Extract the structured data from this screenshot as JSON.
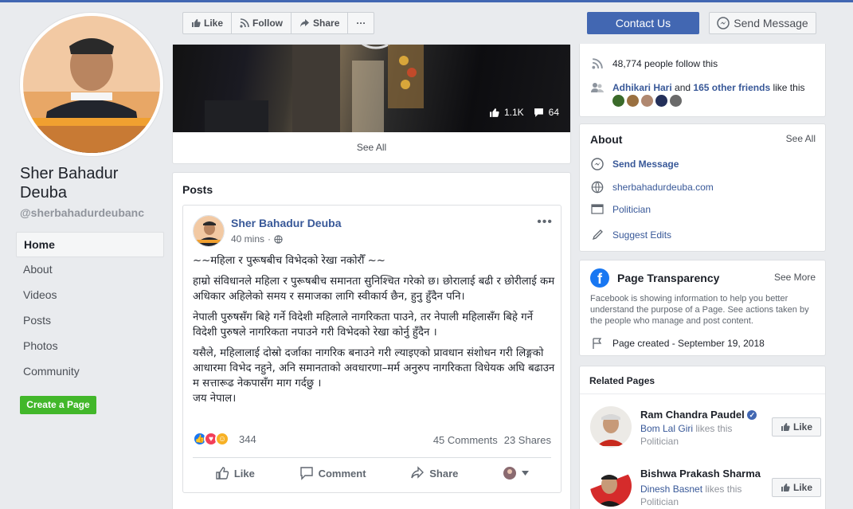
{
  "page": {
    "name": "Sher Bahadur Deuba",
    "username": "@sherbahadurdeubanc"
  },
  "nav": [
    "Home",
    "About",
    "Videos",
    "Posts",
    "Photos",
    "Community"
  ],
  "create_page_label": "Create a Page",
  "actions": {
    "like": "Like",
    "follow": "Follow",
    "share": "Share",
    "more": "···",
    "contact": "Contact Us",
    "send_message": "Send Message"
  },
  "video": {
    "likes": "1.1K",
    "comments": "64",
    "see_all": "See All"
  },
  "community": {
    "follow_count": "48,774 people follow this",
    "friend_name": "Adhikari Hari",
    "friend_connector": "and",
    "friend_others": "165 other friends",
    "friend_suffix": "like this"
  },
  "about": {
    "title": "About",
    "see_all": "See All",
    "send_message": "Send Message",
    "website": "sherbahadurdeuba.com",
    "category": "Politician",
    "suggest_edits": "Suggest Edits"
  },
  "transparency": {
    "title": "Page Transparency",
    "see_more": "See More",
    "description": "Facebook is showing information to help you better understand the purpose of a Page. See actions taken by the people who manage and post content.",
    "created": "Page created - September 19, 2018"
  },
  "posts": {
    "title": "Posts",
    "author": "Sher Bahadur Deuba",
    "time": "40 mins",
    "more": "•••",
    "paragraphs": [
      "~~महिला र पुरूषबीच विभेदको रेखा नकोरौँ ~~",
      "हाम्रो संविधानले महिला र पुरूषबीच समानता सुनिश्चित गरेको छ। छोरालाई बढी र छोरीलाई कम अधिकार अहिलेको समय र समाजका लागि स्वीकार्य छैन, हुनु हुँदैन पनि।",
      "नेपाली पुरुषसँग बिहे गर्ने विदेशी महिलाले नागरिकता पाउने, तर नेपाली महिलासँग बिहे गर्ने विदेशी पुरुषले नागरिकता नपाउने गरी विभेदको रेखा कोर्नु हुँदैन ।",
      "यसैले, महिलालाई दोस्रो दर्जाका नागरिक बनाउने गरी ल्याइएको प्रावधान संशोधन गरी लिङ्गको आधारमा विभेद नहुने, अनि समानताको अवधारणा–मर्म अनुरुप नागरिकता विधेयक अघि बढाउन म सत्तारूढ नेकपासँग माग गर्दछु ।",
      "जय नेपाल।"
    ],
    "reaction_count": "344",
    "comments": "45 Comments",
    "shares": "23 Shares",
    "like": "Like",
    "comment": "Comment",
    "share": "Share"
  },
  "related": {
    "title": "Related Pages",
    "items": [
      {
        "name": "Ram Chandra Paudel",
        "friend": "Bom Lal Giri",
        "likes_text": "likes this",
        "category": "Politician",
        "like": "Like",
        "verified": true
      },
      {
        "name": "Bishwa Prakash Sharma",
        "friend": "Dinesh Basnet",
        "likes_text": "likes this",
        "category": "Politician",
        "like": "Like",
        "verified": false
      }
    ]
  },
  "colors": {
    "brand": "#4267b2",
    "link": "#385898",
    "create_green": "#42b72a",
    "background": "#e9ebee"
  }
}
